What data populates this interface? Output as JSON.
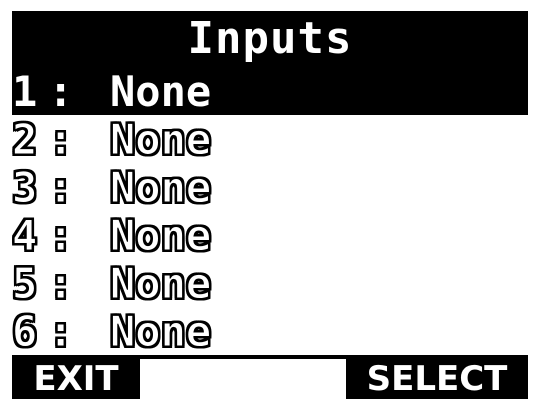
{
  "screen": {
    "title": "Inputs"
  },
  "inputs": [
    {
      "number": "1",
      "separator": ":",
      "value": "None",
      "selected": true
    },
    {
      "number": "2",
      "separator": ":",
      "value": "None",
      "selected": false
    },
    {
      "number": "3",
      "separator": ":",
      "value": "None",
      "selected": false
    },
    {
      "number": "4",
      "separator": ":",
      "value": "None",
      "selected": false
    },
    {
      "number": "5",
      "separator": ":",
      "value": "None",
      "selected": false
    },
    {
      "number": "6",
      "separator": ":",
      "value": "None",
      "selected": false
    }
  ],
  "footer": {
    "exit_label": "EXIT",
    "select_label": "SELECT"
  },
  "colors": {
    "background": "#000000",
    "foreground": "#ffffff",
    "selected_background": "#000000"
  }
}
